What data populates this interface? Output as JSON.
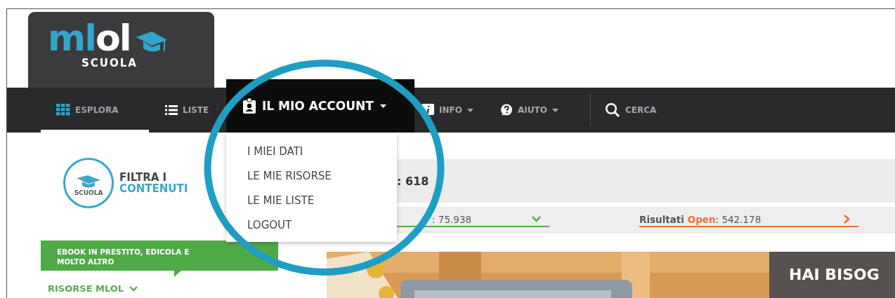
{
  "logo": {
    "accent": "ml",
    "plain": "ol",
    "tagline": "SCUOLA"
  },
  "nav": [
    {
      "label": "ESPLORA",
      "selected": true,
      "kind": "link"
    },
    {
      "label": "LISTE",
      "selected": false,
      "kind": "link"
    },
    {
      "label": "IL MIO ACCOUNT",
      "selected": false,
      "expanded": true,
      "kind": "tab"
    },
    {
      "label": "INFO",
      "selected": false,
      "kind": "menu"
    },
    {
      "label": "AIUTO",
      "selected": false,
      "kind": "menu"
    },
    {
      "label": "CERCA",
      "selected": false,
      "kind": "search"
    }
  ],
  "account_menu": [
    "I MIEI DATI",
    "LE MIE RISORSE",
    "LE MIE LISTE",
    "LOGOUT"
  ],
  "filter": {
    "badge": "SCUOLA",
    "line1": "FILTRA I",
    "line2": "CONTENUTI"
  },
  "banner": "EBOOK IN PRESTITO, EDICOLA E MOLTO ALTRO",
  "resources_toggle": "RISORSE MLOL",
  "total": ": 618",
  "results": [
    {
      "value": ": 75.938",
      "color": "#5aad4e",
      "kind": "dropdown"
    },
    {
      "label": "Risultati",
      "highlight": "Open",
      "value": ": 542.178",
      "color": "#e8703a",
      "kind": "link"
    }
  ],
  "promo": {
    "kind": "picture",
    "heading": "HAI BISOG"
  }
}
